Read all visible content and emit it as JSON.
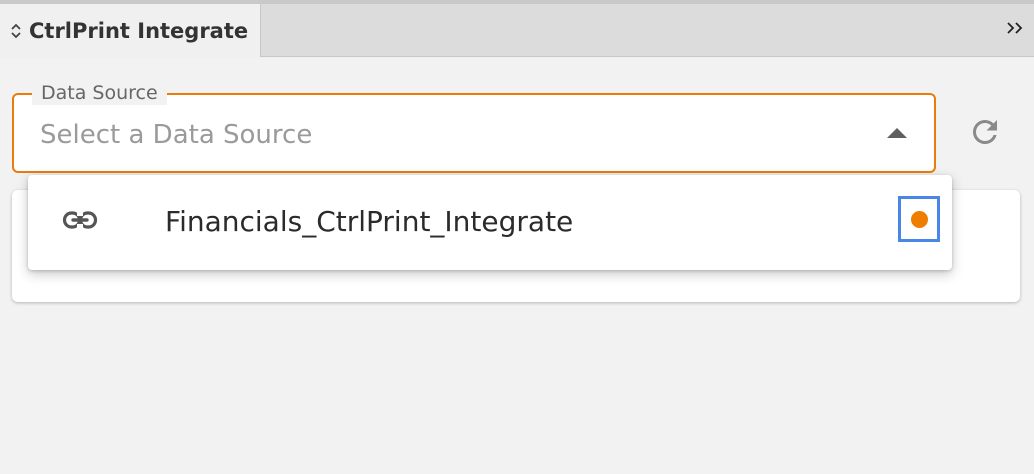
{
  "panel": {
    "tab_title": "CtrlPrint Integrate",
    "tab_icon": "sort-arrows-icon",
    "collapse_icon": "double-chevron-right-icon"
  },
  "data_source": {
    "label": "Data Source",
    "placeholder": "Select a Data Source",
    "state": "open",
    "caret_icon": "caret-up-icon",
    "refresh_icon": "refresh-icon"
  },
  "dropdown": {
    "options": [
      {
        "label": "Financials_CtrlPrint_Integrate",
        "icon": "link-icon",
        "status_icon": "status-dot-icon"
      }
    ]
  },
  "colors": {
    "accent": "#e87d0d",
    "status_dot": "#ef7d00",
    "focus_outline": "#4a86e8",
    "panel_bg": "#f2f2f2"
  }
}
